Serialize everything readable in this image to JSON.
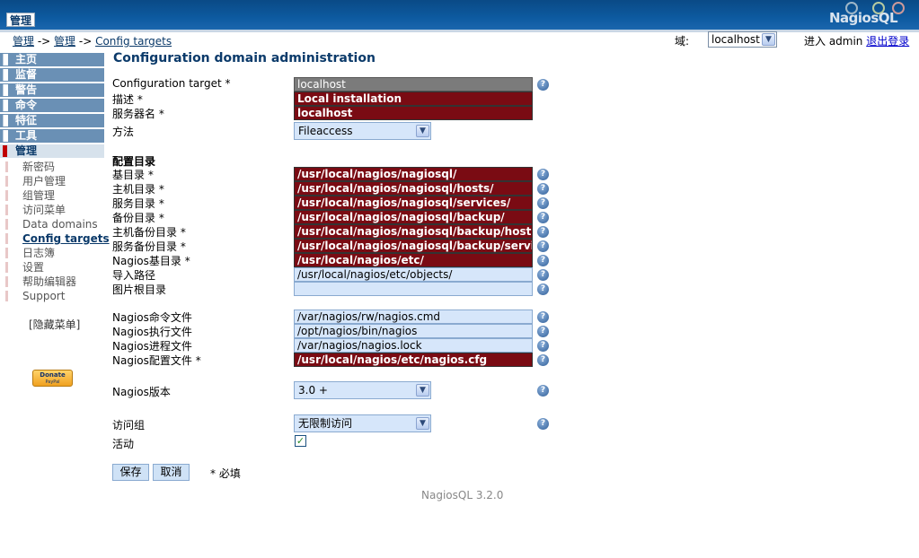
{
  "header": {
    "tab_label": "管理",
    "logo": "NagiosQL"
  },
  "breadcrumb": {
    "item1": "管理",
    "sep1": " -> ",
    "item2": "管理",
    "sep2": " -> ",
    "item3": "Config targets"
  },
  "domain": {
    "label": "域:",
    "selected": "localhost"
  },
  "login": {
    "text": "进入 admin ",
    "logout": "退出登录"
  },
  "sidebar": {
    "main_items": [
      "主页",
      "监督",
      "警告",
      "命令",
      "特征",
      "工具",
      "管理"
    ],
    "active_main": "管理",
    "sub_items": [
      "新密码",
      "用户管理",
      "组管理",
      "访问菜单",
      "Data domains",
      "Config targets",
      "日志簿",
      "设置",
      "帮助编辑器",
      "Support"
    ],
    "active_sub": "Config targets",
    "hide_menu": "[隐藏菜单]",
    "donate_label": "Donate",
    "donate_sub": "PayPal"
  },
  "main": {
    "title": "Configuration domain administration",
    "fields": {
      "config_target": {
        "label": "Configuration target *",
        "value": "localhost"
      },
      "description": {
        "label": "描述 *",
        "value": "Local installation"
      },
      "server_name": {
        "label": "服务器名 *",
        "value": "localhost"
      },
      "method": {
        "label": "方法",
        "value": "Fileaccess"
      }
    },
    "config_dir_heading": "配置目录",
    "dirs": [
      {
        "label": "基目录 *",
        "value": "/usr/local/nagios/nagiosql/"
      },
      {
        "label": "主机目录 *",
        "value": "/usr/local/nagios/nagiosql/hosts/"
      },
      {
        "label": "服务目录 *",
        "value": "/usr/local/nagios/nagiosql/services/"
      },
      {
        "label": "备份目录 *",
        "value": "/usr/local/nagios/nagiosql/backup/"
      },
      {
        "label": "主机备份目录 *",
        "value": "/usr/local/nagios/nagiosql/backup/hosts/"
      },
      {
        "label": "服务备份目录 *",
        "value": "/usr/local/nagios/nagiosql/backup/services/"
      },
      {
        "label": "Nagios基目录 *",
        "value": "/usr/local/nagios/etc/"
      },
      {
        "label": "导入路径",
        "value": "/usr/local/nagios/etc/objects/"
      },
      {
        "label": "图片根目录",
        "value": ""
      }
    ],
    "nagios_files": [
      {
        "label": "Nagios命令文件",
        "value": "/var/nagios/rw/nagios.cmd"
      },
      {
        "label": "Nagios执行文件",
        "value": "/opt/nagios/bin/nagios"
      },
      {
        "label": "Nagios进程文件",
        "value": "/var/nagios/nagios.lock"
      },
      {
        "label": "Nagios配置文件 *",
        "value": "/usr/local/nagios/etc/nagios.cfg"
      }
    ],
    "version": {
      "label": "Nagios版本",
      "value": "3.0 +"
    },
    "access_group": {
      "label": "访问组",
      "value": "无限制访问"
    },
    "active": {
      "label": "活动",
      "checked": true
    },
    "buttons": {
      "save": "保存",
      "cancel": "取消"
    },
    "required_note": "* 必填"
  },
  "footer": {
    "version": "NagiosQL 3.2.0"
  },
  "colors": {
    "header_blue": "#0d5aa0",
    "required_bg": "#7a0b13",
    "optional_bg": "#d6e6fa",
    "title_blue": "#0b3a6a"
  }
}
